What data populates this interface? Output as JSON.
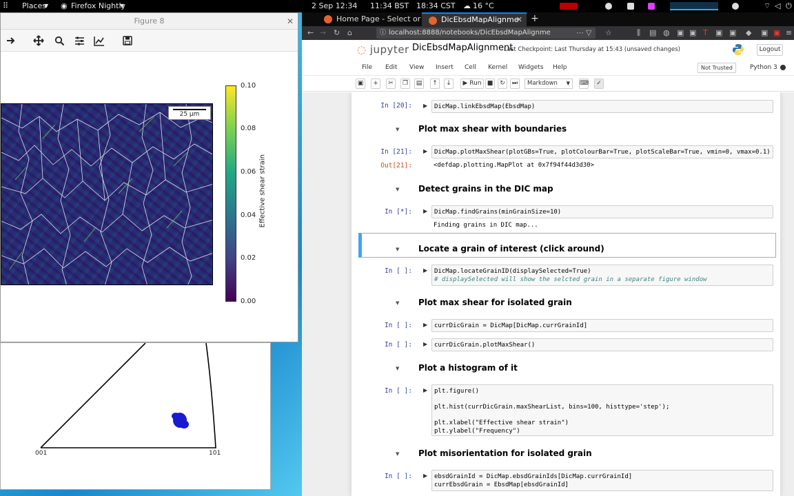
{
  "top_panel": {
    "places": "Places",
    "app": "Firefox Nightly",
    "clock_left": "2 Sep 12:34",
    "clock_bst": "11:34 BST",
    "clock_cst": "18:34 CST",
    "weather": "16 °C"
  },
  "figure_window": {
    "title": "Figure 8",
    "scalebar_text": "25 µm",
    "colorbar": {
      "label": "Effective shear strain",
      "ticks": [
        "0.10",
        "0.08",
        "0.06",
        "0.04",
        "0.02",
        "0.00"
      ],
      "colors": [
        "#440154",
        "#414487",
        "#2a788e",
        "#22a884",
        "#7ad151",
        "#fde725"
      ]
    }
  },
  "ipf_window": {
    "corner_001": "001",
    "corner_101": "101"
  },
  "browser": {
    "tabs": [
      {
        "label": "Home Page - Select or"
      },
      {
        "label": "DicEbsdMapAlignme"
      }
    ],
    "url": "localhost:8888/notebooks/DicEbsdMapAlignme"
  },
  "jupyter": {
    "logo": "jupyter",
    "notebook_name": "DicEbsdMapAlignment",
    "checkpoint": "Last Checkpoint: Last Thursday at 15:43  (unsaved changes)",
    "logout": "Logout",
    "menu": [
      "File",
      "Edit",
      "View",
      "Insert",
      "Cell",
      "Kernel",
      "Widgets",
      "Help"
    ],
    "trust": "Not Trusted",
    "kernel": "Python 3",
    "toolbar": {
      "run": "Run",
      "cell_type": "Markdown"
    }
  },
  "cells": [
    {
      "type": "code",
      "prompt": "In [20]:",
      "code": "DicMap.linkEbsdMap(EbsdMap)"
    },
    {
      "type": "md",
      "text": "Plot max shear with boundaries"
    },
    {
      "type": "code",
      "prompt": "In [21]:",
      "code": "DicMap.plotMaxShear(plotGBs=True, plotColourBar=True, plotScaleBar=True, vmin=0, vmax=0.1)",
      "out_prompt": "Out[21]:",
      "output": "<defdap.plotting.MapPlot at 0x7f94f44d3d30>"
    },
    {
      "type": "md",
      "text": "Detect grains in the DIC map"
    },
    {
      "type": "code",
      "prompt": "In [*]:",
      "code": "DicMap.findGrains(minGrainSize=10)",
      "output": "Finding grains in DIC map..."
    },
    {
      "type": "md",
      "text": "Locate a grain of interest (click around)"
    },
    {
      "type": "code",
      "prompt": "In [ ]:",
      "code": "DicMap.locateGrainID(displaySelected=True)",
      "comment": "# displaySelected will show the selcted grain in a separate figure window"
    },
    {
      "type": "md",
      "text": "Plot max shear for isolated grain"
    },
    {
      "type": "code",
      "prompt": "In [ ]:",
      "code": "currDicGrain = DicMap[DicMap.currGrainId]"
    },
    {
      "type": "code",
      "prompt": "In [ ]:",
      "code": "currDicGrain.plotMaxShear()"
    },
    {
      "type": "md",
      "text": "Plot a histogram of it"
    },
    {
      "type": "code",
      "prompt": "In [ ]:",
      "code": "plt.figure()",
      "code2": "plt.hist(currDicGrain.maxShearList, bins=100, histtype='step');",
      "code3": "plt.xlabel(\"Effective shear strain\")",
      "code4": "plt.ylabel(\"Frequency\")"
    },
    {
      "type": "md",
      "text": "Plot misorientation for isolated grain"
    },
    {
      "type": "code",
      "prompt": "In [ ]:",
      "code": "ebsdGrainId = DicMap.ebsdGrainIds[DicMap.currGrainId]",
      "code2": "currEbsdGrain = EbsdMap[ebsdGrainId]"
    }
  ]
}
